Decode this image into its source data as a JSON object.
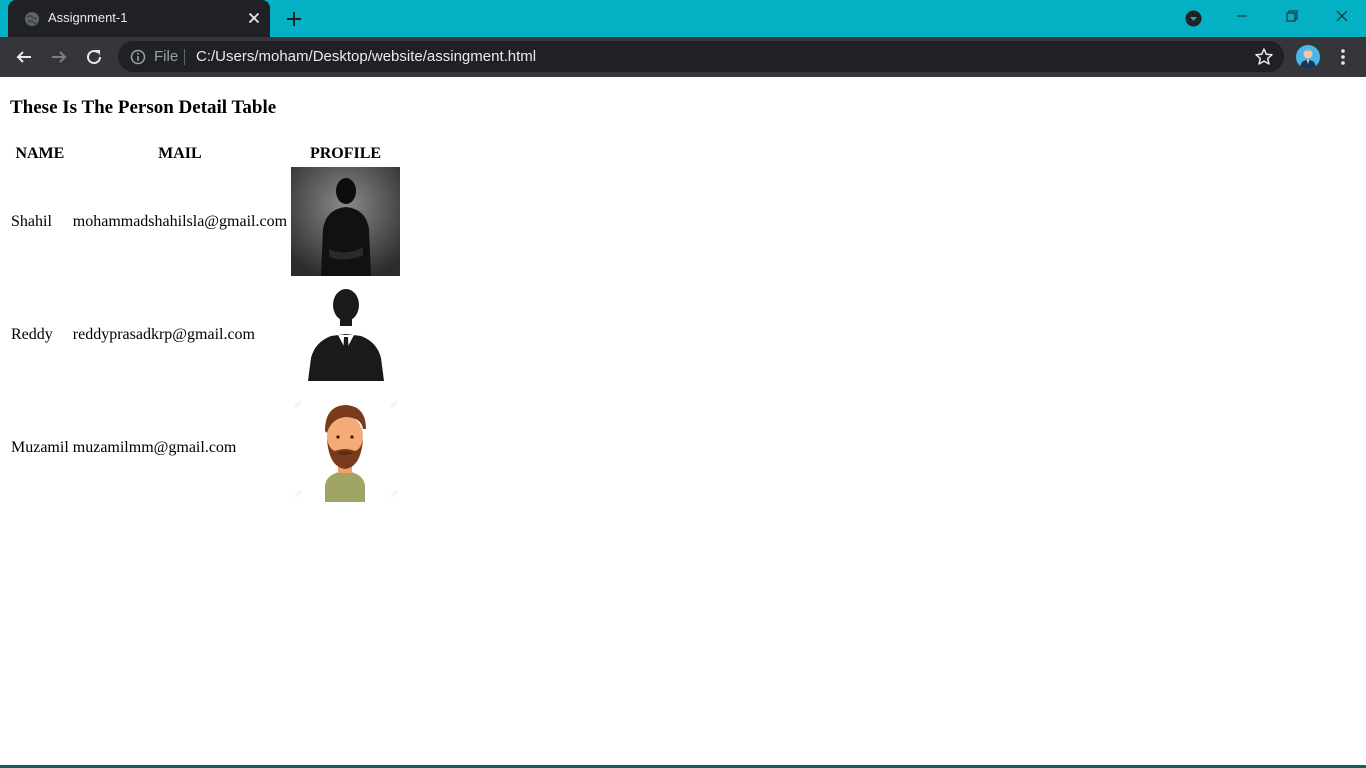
{
  "browser": {
    "tab_title": "Assignment-1",
    "address": {
      "security_label": "File",
      "url": "C:/Users/moham/Desktop/website/assingment.html"
    },
    "colors": {
      "frame": "#03b0c4",
      "toolbar": "#35363a",
      "tab": "#202124"
    }
  },
  "page": {
    "heading": "These Is The Person Detail Table",
    "table": {
      "headers": [
        "NAME",
        "MAIL",
        "PROFILE"
      ],
      "rows": [
        {
          "name": "Shahil",
          "mail": "mohammadshahilsla@gmail.com",
          "profile_icon": "dark-silhouette-photo"
        },
        {
          "name": "Reddy",
          "mail": "reddyprasadkrp@gmail.com",
          "profile_icon": "suit-silhouette-icon"
        },
        {
          "name": "Muzamil",
          "mail": "muzamilmm@gmail.com",
          "profile_icon": "bearded-man-cartoon-avatar"
        }
      ]
    }
  }
}
